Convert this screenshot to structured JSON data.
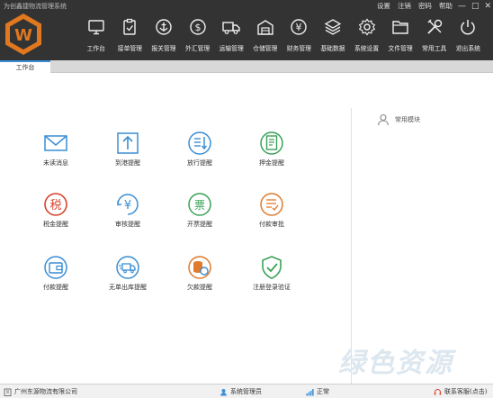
{
  "app": {
    "title": "为创鑫捷物流管理系统"
  },
  "sys_menu": {
    "settings": "设置",
    "logout": "注销",
    "password": "密码",
    "help": "帮助",
    "minimize": "—",
    "maximize": "□",
    "close": "✕"
  },
  "logo": {
    "letter": "W"
  },
  "nav": [
    {
      "label": "工作台",
      "icon": "monitor-icon"
    },
    {
      "label": "接单管理",
      "icon": "clipboard-check-icon"
    },
    {
      "label": "报关管理",
      "icon": "anchor-icon"
    },
    {
      "label": "外汇管理",
      "icon": "dollar-icon"
    },
    {
      "label": "运输管理",
      "icon": "truck-icon"
    },
    {
      "label": "仓储管理",
      "icon": "warehouse-icon"
    },
    {
      "label": "财务管理",
      "icon": "yen-icon"
    },
    {
      "label": "基础数据",
      "icon": "layers-icon"
    },
    {
      "label": "系统设置",
      "icon": "gear-icon"
    },
    {
      "label": "文件管理",
      "icon": "folder-icon"
    },
    {
      "label": "常用工具",
      "icon": "tools-icon"
    },
    {
      "label": "退出系统",
      "icon": "power-icon"
    }
  ],
  "tabs": [
    {
      "label": "工作台"
    }
  ],
  "tiles": [
    {
      "label": "未读消息",
      "icon": "envelope-icon",
      "color": "#3a8ed4"
    },
    {
      "label": "到港提醒",
      "icon": "arrow-up-box-icon",
      "color": "#3a8ed4"
    },
    {
      "label": "放行提醒",
      "icon": "release-icon",
      "color": "#3a8ed4"
    },
    {
      "label": "押金提醒",
      "icon": "deposit-doc-icon",
      "color": "#3aa157"
    },
    {
      "label": "税金提醒",
      "icon": "tax-icon",
      "color": "#d8432e",
      "glyph": "税"
    },
    {
      "label": "审核提醒",
      "icon": "audit-yen-icon",
      "color": "#3a8ed4",
      "glyph": "¥"
    },
    {
      "label": "开票提醒",
      "icon": "invoice-icon",
      "color": "#3aa157",
      "glyph": "票"
    },
    {
      "label": "付款审批",
      "icon": "payment-approval-icon",
      "color": "#e07a2c"
    },
    {
      "label": "付款提醒",
      "icon": "wallet-icon",
      "color": "#3a8ed4"
    },
    {
      "label": "无单出库提醒",
      "icon": "fast-truck-icon",
      "color": "#3a8ed4"
    },
    {
      "label": "欠款提醒",
      "icon": "coins-icon",
      "color": "#e07a2c"
    },
    {
      "label": "注册登录验证",
      "icon": "shield-check-icon",
      "color": "#3aa157"
    }
  ],
  "side": {
    "title": "常用模块"
  },
  "watermark": "绿色资源",
  "status": {
    "company": "广州东源物流有限公司",
    "user": "系统管理员",
    "state": "正常",
    "contact": "联系客服(点击)"
  },
  "colors": {
    "header_bg": "#333333",
    "accent": "#3b8ed8",
    "logo_orange": "#e0781f"
  }
}
